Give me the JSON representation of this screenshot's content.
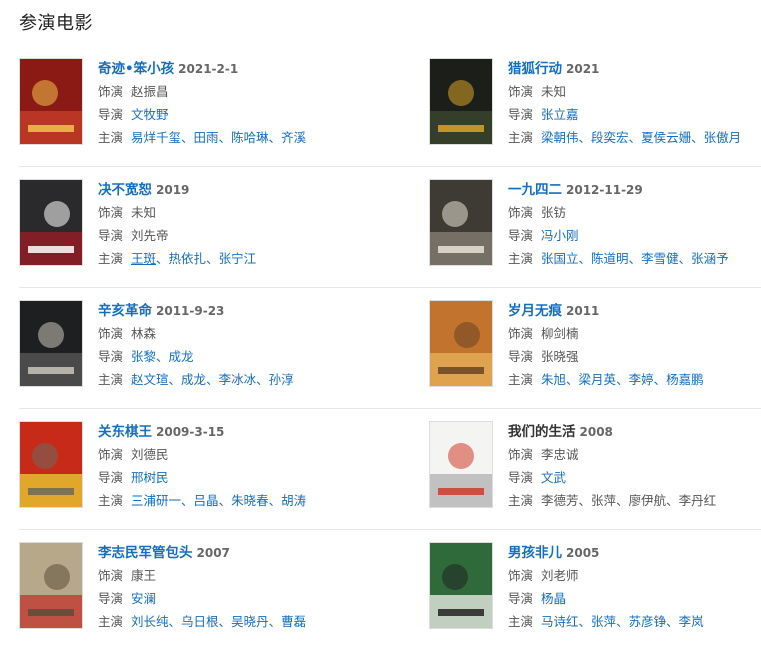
{
  "section": {
    "title": "参演电影"
  },
  "labels": {
    "role": "饰演",
    "director": "导演",
    "stars": "主演",
    "separator": "、"
  },
  "films": [
    {
      "title": "奇迹•笨小孩",
      "date": "2021-2-1",
      "title_link": true,
      "role": {
        "text": "赵振昌",
        "link": false
      },
      "director": {
        "text": "文牧野",
        "link": true
      },
      "stars": [
        {
          "text": "易烊千玺",
          "link": true
        },
        {
          "text": "田雨",
          "link": true
        },
        {
          "text": "陈哈琳",
          "link": true
        },
        {
          "text": "齐溪",
          "link": true
        }
      ],
      "poster": {
        "icon": "film-poster",
        "colors": [
          "#8b1a14",
          "#c8402a",
          "#f0c24a"
        ]
      }
    },
    {
      "title": "猎狐行动",
      "date": "2021",
      "title_link": true,
      "role": {
        "text": "未知",
        "link": false
      },
      "director": {
        "text": "张立嘉",
        "link": true
      },
      "stars": [
        {
          "text": "梁朝伟",
          "link": true
        },
        {
          "text": "段奕宏",
          "link": true
        },
        {
          "text": "夏侯云姗",
          "link": true
        },
        {
          "text": "张傲月",
          "link": true
        }
      ],
      "poster": {
        "icon": "film-poster",
        "colors": [
          "#1c1e1a",
          "#3c4a2e",
          "#d9a325"
        ]
      }
    },
    {
      "title": "决不宽恕",
      "date": "2019",
      "title_link": true,
      "role": {
        "text": "未知",
        "link": false
      },
      "director": {
        "text": "刘先帝",
        "link": false
      },
      "stars": [
        {
          "text": "王斑",
          "link": true,
          "underline": true
        },
        {
          "text": "热依扎",
          "link": true
        },
        {
          "text": "张宁江",
          "link": true
        }
      ],
      "poster": {
        "icon": "film-poster",
        "colors": [
          "#2a2a2c",
          "#a01c24",
          "#ffffff"
        ]
      }
    },
    {
      "title": "一九四二",
      "date": "2012-11-29",
      "title_link": true,
      "role": {
        "text": "张钫",
        "link": false
      },
      "director": {
        "text": "冯小刚",
        "link": true
      },
      "stars": [
        {
          "text": "张国立",
          "link": true
        },
        {
          "text": "陈道明",
          "link": true
        },
        {
          "text": "李雪健",
          "link": true
        },
        {
          "text": "张涵予",
          "link": true
        }
      ],
      "poster": {
        "icon": "film-poster",
        "colors": [
          "#3e3a34",
          "#8a8276",
          "#e8e2d6"
        ]
      }
    },
    {
      "title": "辛亥革命",
      "date": "2011-9-23",
      "title_link": true,
      "role": {
        "text": "林森",
        "link": false
      },
      "director": {
        "text": "张黎、成龙",
        "link": true
      },
      "stars": [
        {
          "text": "赵文瑄",
          "link": true
        },
        {
          "text": "成龙",
          "link": true
        },
        {
          "text": "李冰冰",
          "link": true
        },
        {
          "text": "孙淳",
          "link": true
        }
      ],
      "poster": {
        "icon": "film-poster",
        "colors": [
          "#1e1f20",
          "#5a5a58",
          "#c8c4ba"
        ]
      }
    },
    {
      "title": "岁月无痕",
      "date": "2011",
      "title_link": true,
      "role": {
        "text": "柳剑楠",
        "link": false
      },
      "director": {
        "text": "张晓强",
        "link": false
      },
      "stars": [
        {
          "text": "朱旭",
          "link": true
        },
        {
          "text": "梁月英",
          "link": true
        },
        {
          "text": "李婷",
          "link": true
        },
        {
          "text": "杨嘉鹏",
          "link": true
        }
      ],
      "poster": {
        "icon": "film-poster",
        "colors": [
          "#c2742e",
          "#e8b25a",
          "#6a4424"
        ]
      }
    },
    {
      "title": "关东棋王",
      "date": "2009-3-15",
      "title_link": true,
      "role": {
        "text": "刘德民",
        "link": false
      },
      "director": {
        "text": "邢树民",
        "link": true
      },
      "stars": [
        {
          "text": "三浦研一",
          "link": true
        },
        {
          "text": "吕晶",
          "link": true
        },
        {
          "text": "朱晓春",
          "link": true
        },
        {
          "text": "胡涛",
          "link": true
        }
      ],
      "poster": {
        "icon": "film-poster",
        "colors": [
          "#c82a1a",
          "#e8d230",
          "#6a6a5c"
        ]
      }
    },
    {
      "title": "我们的生活",
      "date": "2008",
      "title_link": false,
      "role": {
        "text": "李忠诚",
        "link": false
      },
      "director": {
        "text": "文武",
        "link": true
      },
      "stars": [
        {
          "text": "李德芳",
          "link": false
        },
        {
          "text": "张萍",
          "link": false
        },
        {
          "text": "廖伊航",
          "link": false
        },
        {
          "text": "李丹红",
          "link": false
        }
      ],
      "poster": {
        "icon": "film-poster",
        "colors": [
          "#f4f4f2",
          "#b0b0b0",
          "#d23a2a"
        ]
      }
    },
    {
      "title": "李志民军管包头",
      "date": "2007",
      "title_link": true,
      "role": {
        "text": "康王",
        "link": false
      },
      "director": {
        "text": "安澜",
        "link": true
      },
      "stars": [
        {
          "text": "刘长纯",
          "link": true
        },
        {
          "text": "乌日根",
          "link": true
        },
        {
          "text": "吴晓丹",
          "link": true
        },
        {
          "text": "曹磊",
          "link": true
        }
      ],
      "poster": {
        "icon": "film-poster",
        "colors": [
          "#b8a88a",
          "#c0342a",
          "#5a4e3a"
        ]
      }
    },
    {
      "title": "男孩非儿",
      "date": "2005",
      "title_link": true,
      "role": {
        "text": "刘老师",
        "link": false
      },
      "director": {
        "text": "杨晶",
        "link": true
      },
      "stars": [
        {
          "text": "马诗红",
          "link": true
        },
        {
          "text": "张萍",
          "link": true
        },
        {
          "text": "苏彦铮",
          "link": true
        },
        {
          "text": "李岚",
          "link": true
        }
      ],
      "poster": {
        "icon": "film-poster",
        "colors": [
          "#2e6a3a",
          "#f2f2ee",
          "#222222"
        ]
      }
    }
  ]
}
